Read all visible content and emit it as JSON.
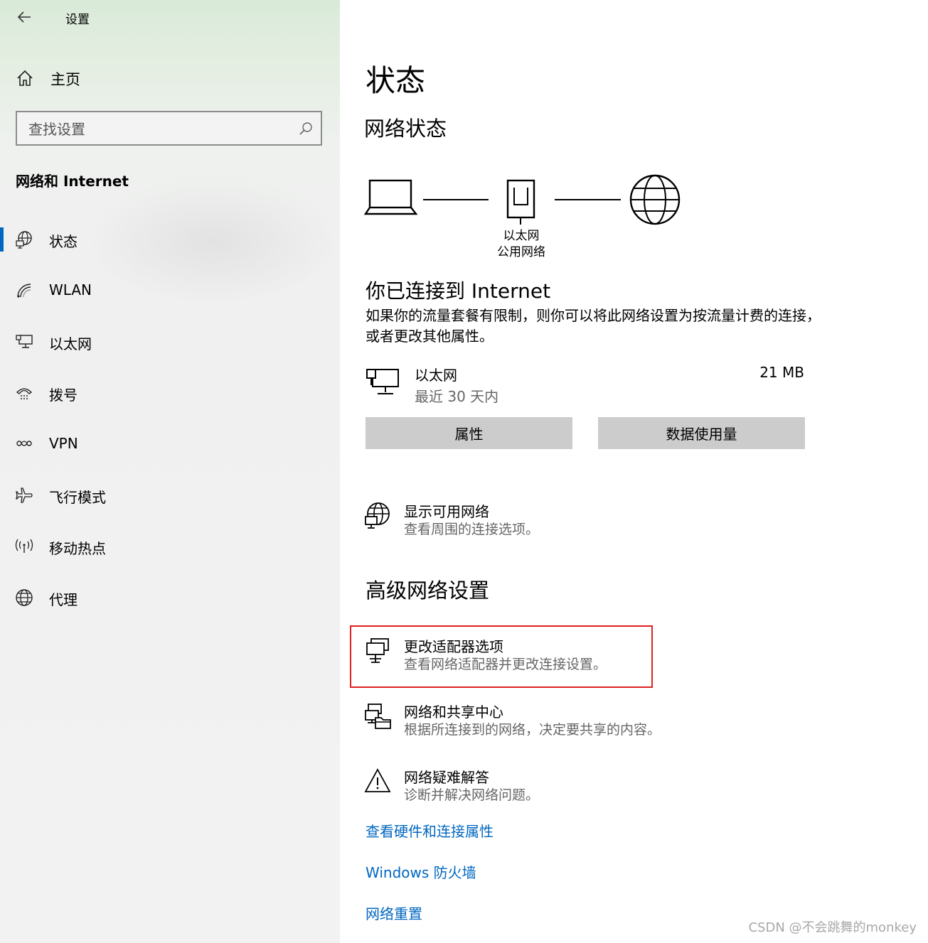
{
  "window": {
    "title": "设置"
  },
  "sidebar": {
    "home_label": "主页",
    "search_placeholder": "查找设置",
    "section_heading": "网络和 Internet",
    "items": [
      {
        "label": "状态",
        "icon": "status-globe-icon",
        "active": true
      },
      {
        "label": "WLAN",
        "icon": "wifi-icon",
        "active": false
      },
      {
        "label": "以太网",
        "icon": "ethernet-icon",
        "active": false
      },
      {
        "label": "拨号",
        "icon": "dialup-icon",
        "active": false
      },
      {
        "label": "VPN",
        "icon": "vpn-icon",
        "active": false
      },
      {
        "label": "飞行模式",
        "icon": "airplane-icon",
        "active": false
      },
      {
        "label": "移动热点",
        "icon": "hotspot-icon",
        "active": false
      },
      {
        "label": "代理",
        "icon": "globe-icon",
        "active": false
      }
    ]
  },
  "main": {
    "title": "状态",
    "network_status_heading": "网络状态",
    "diagram": {
      "adapter_name": "以太网",
      "network_profile": "公用网络"
    },
    "connected_title": "你已连接到 Internet",
    "connected_desc": "如果你的流量套餐有限制，则你可以将此网络设置为按流量计费的连接，或者更改其他属性。",
    "ethernet": {
      "name": "以太网",
      "period": "最近 30 天内",
      "usage": "21 MB"
    },
    "buttons": {
      "properties": "属性",
      "data_usage": "数据使用量"
    },
    "show_networks": {
      "title": "显示可用网络",
      "desc": "查看周围的连接选项。"
    },
    "advanced_heading": "高级网络设置",
    "advanced_items": [
      {
        "title": "更改适配器选项",
        "desc": "查看网络适配器并更改连接设置。",
        "icon": "adapter-icon"
      },
      {
        "title": "网络和共享中心",
        "desc": "根据所连接到的网络，决定要共享的内容。",
        "icon": "sharing-center-icon"
      },
      {
        "title": "网络疑难解答",
        "desc": "诊断并解决网络问题。",
        "icon": "warning-icon"
      }
    ],
    "links": [
      "查看硬件和连接属性",
      "Windows 防火墙",
      "网络重置"
    ],
    "accent_color": "#0067c0",
    "highlight_color": "#e02020"
  },
  "watermark": "CSDN @不会跳舞的monkey"
}
